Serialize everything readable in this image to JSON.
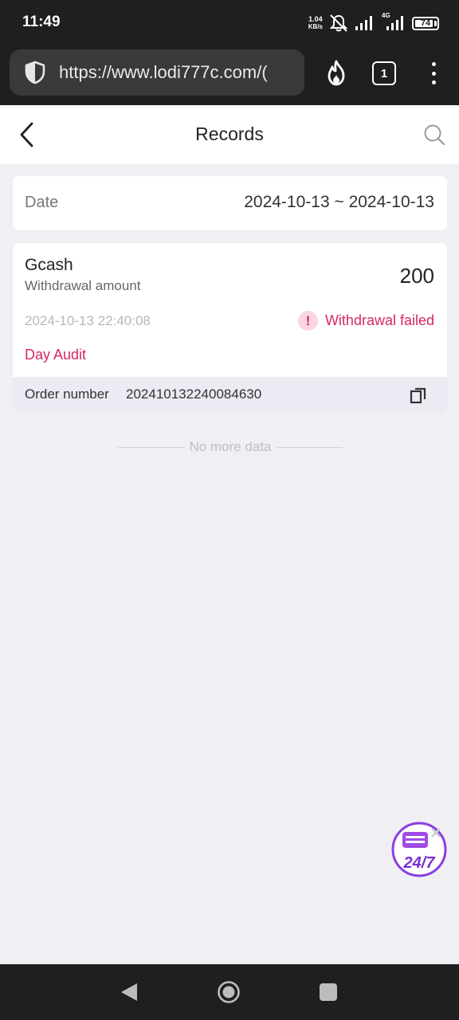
{
  "status_bar": {
    "time": "11:49",
    "net_speed_value": "1.04",
    "net_speed_unit": "KB/s",
    "network_type": "4G",
    "battery_level": "74",
    "icons": [
      "mute-icon",
      "signal-icon",
      "signal-4g-icon",
      "battery-icon"
    ]
  },
  "browser": {
    "url": "https://www.lodi777c.com/(",
    "tab_count": "1",
    "icons": [
      "shield-icon",
      "fire-icon",
      "tabs-icon",
      "more-icon"
    ]
  },
  "header": {
    "title": "Records",
    "icons": [
      "back-arrow-icon",
      "search-icon"
    ]
  },
  "filter": {
    "date_label": "Date",
    "date_range": "2024-10-13 ~ 2024-10-13"
  },
  "records": [
    {
      "method": "Gcash",
      "amount_label": "Withdrawal amount",
      "amount": "200",
      "time": "2024-10-13 22:40:08",
      "status": "Withdrawal failed",
      "status_icon": "alert-icon",
      "audit": "Day Audit",
      "order_label": "Order number",
      "order_number": "202410132240084630",
      "copy_icon": "copy-icon"
    }
  ],
  "list_footer": "No more data",
  "support": {
    "label": "24/7",
    "icon": "support-chat-icon"
  },
  "nav": {
    "icons": [
      "nav-back-icon",
      "nav-home-icon",
      "nav-recents-icon"
    ]
  },
  "colors": {
    "accent": "#d6285e",
    "page_background": "#efeff4",
    "system_bar": "#1f1f1f",
    "order_row": "#eaebf3"
  }
}
